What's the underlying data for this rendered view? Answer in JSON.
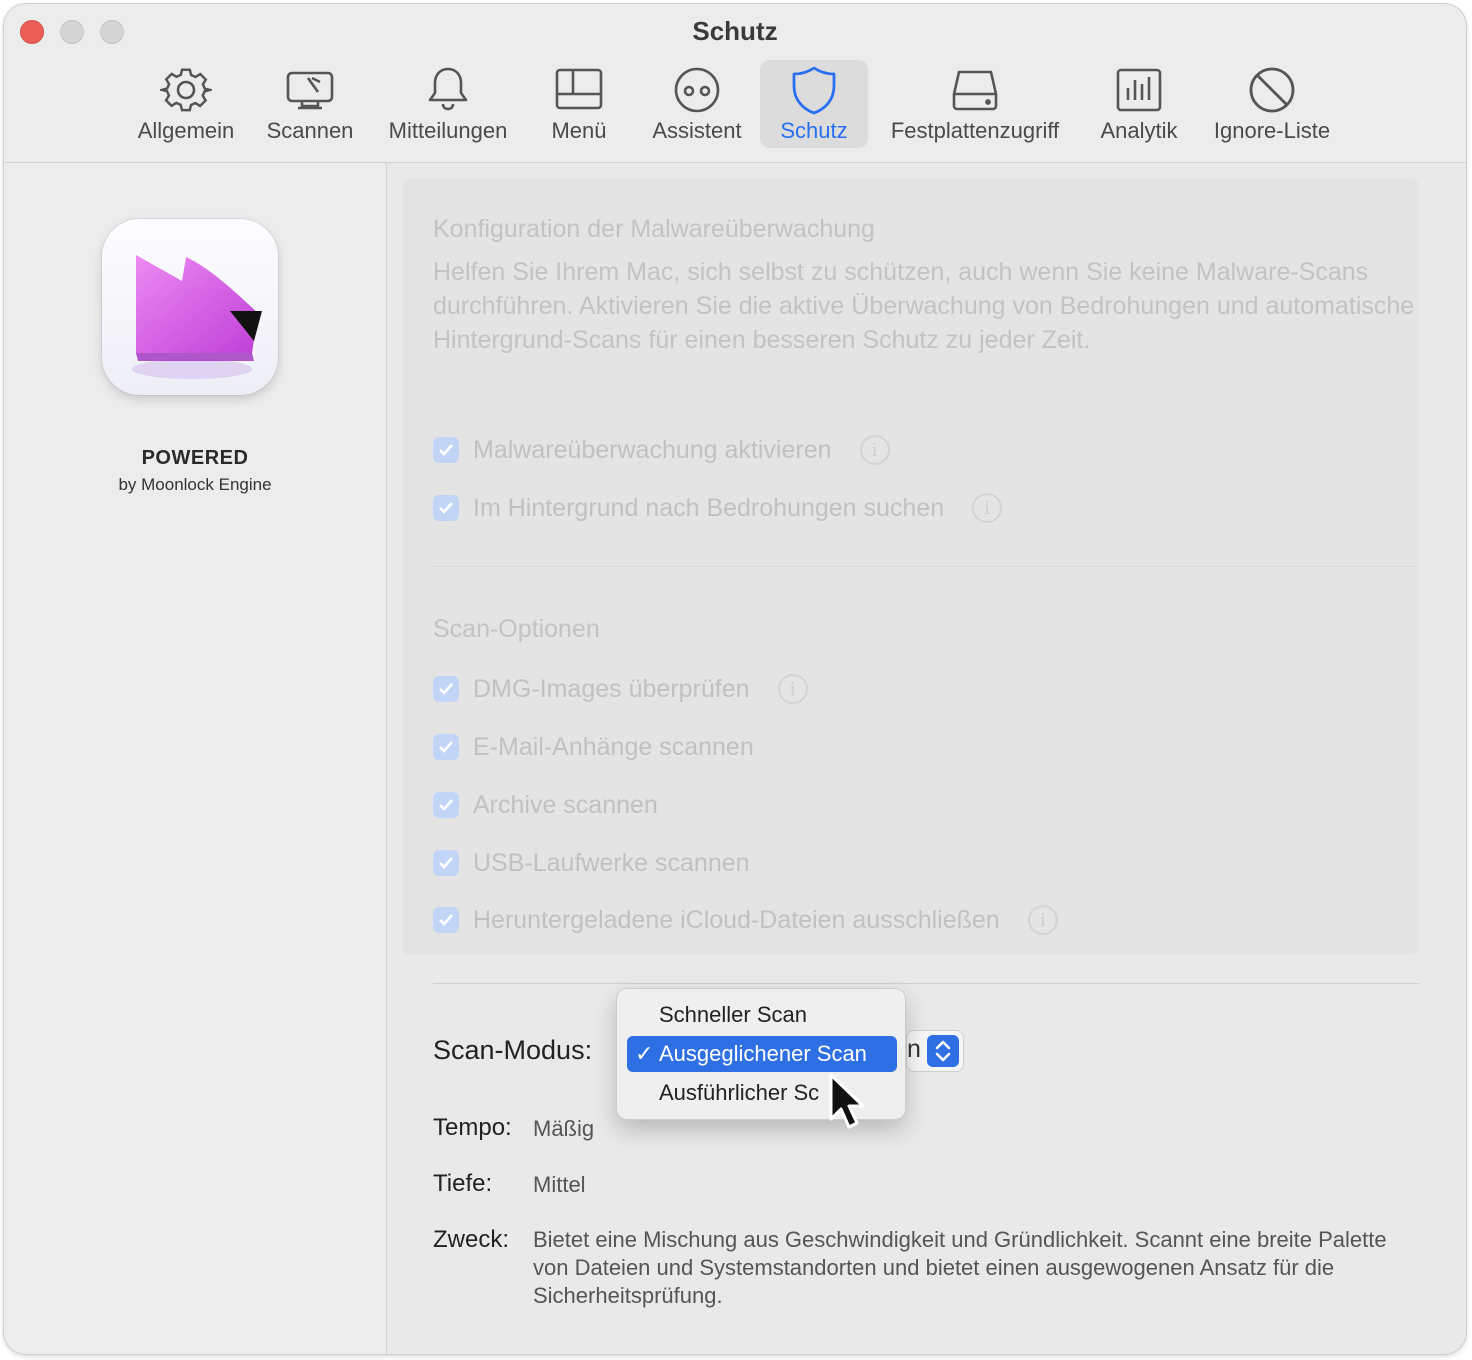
{
  "window": {
    "title": "Schutz"
  },
  "tabs": [
    {
      "label": "Allgemein",
      "icon": "gear-icon"
    },
    {
      "label": "Scannen",
      "icon": "monitor-scan-icon"
    },
    {
      "label": "Mitteilungen",
      "icon": "bell-icon"
    },
    {
      "label": "Menü",
      "icon": "menu-layout-icon"
    },
    {
      "label": "Assistent",
      "icon": "assistant-eyes-icon"
    },
    {
      "label": "Schutz",
      "icon": "shield-icon",
      "active": true
    },
    {
      "label": "Festplattenzugriff",
      "icon": "disk-icon"
    },
    {
      "label": "Analytik",
      "icon": "chart-icon"
    },
    {
      "label": "Ignore-Liste",
      "icon": "block-icon"
    }
  ],
  "sidebar": {
    "powered": "POWERED",
    "engine": "by Moonlock Engine"
  },
  "monitoring": {
    "title": "Konfiguration der Malwareüberwachung",
    "description": "Helfen Sie Ihrem Mac, sich selbst zu schützen, auch wenn Sie keine Malware-Scans durchführen. Aktivieren Sie die aktive Überwachung von Bedrohungen und automatische Hintergrund-Scans für einen besseren Schutz zu jeder Zeit.",
    "options": [
      {
        "label": "Malwareüberwachung aktivieren",
        "checked": true,
        "info": true
      },
      {
        "label": "Im Hintergrund nach Bedrohungen suchen",
        "checked": true,
        "info": true
      }
    ]
  },
  "scan_options": {
    "title": "Scan-Optionen",
    "options": [
      {
        "label": "DMG-Images überprüfen",
        "checked": true,
        "info": true
      },
      {
        "label": "E-Mail-Anhänge scannen",
        "checked": true,
        "info": false
      },
      {
        "label": "Archive scannen",
        "checked": true,
        "info": false
      },
      {
        "label": "USB-Laufwerke scannen",
        "checked": true,
        "info": false
      },
      {
        "label": "Heruntergeladene iCloud-Dateien ausschließen",
        "checked": true,
        "info": true
      }
    ]
  },
  "scan_mode": {
    "label": "Scan-Modus:",
    "button_hint": "n",
    "selected_mark": "✓",
    "options": [
      {
        "label": "Schneller Scan",
        "selected": false
      },
      {
        "label": "Ausgeglichener Scan",
        "selected": true
      },
      {
        "label": "Ausführlicher Sc",
        "selected": false
      }
    ]
  },
  "details": {
    "tempo_label": "Tempo:",
    "tempo_value": "Mäßig",
    "depth_label": "Tiefe:",
    "depth_value": "Mittel",
    "purpose_label": "Zweck:",
    "purpose_value": "Bietet eine Mischung aus Geschwindigkeit und Gründlichkeit. Scannt eine breite Palette von Dateien und Systemstandorten und bietet einen ausgewogenen Ansatz für die Sicherheitsprüfung."
  },
  "colors": {
    "accent": "#2f6fe4",
    "close": "#ec5f57",
    "checkbox_disabled": "#c2d5f7"
  }
}
